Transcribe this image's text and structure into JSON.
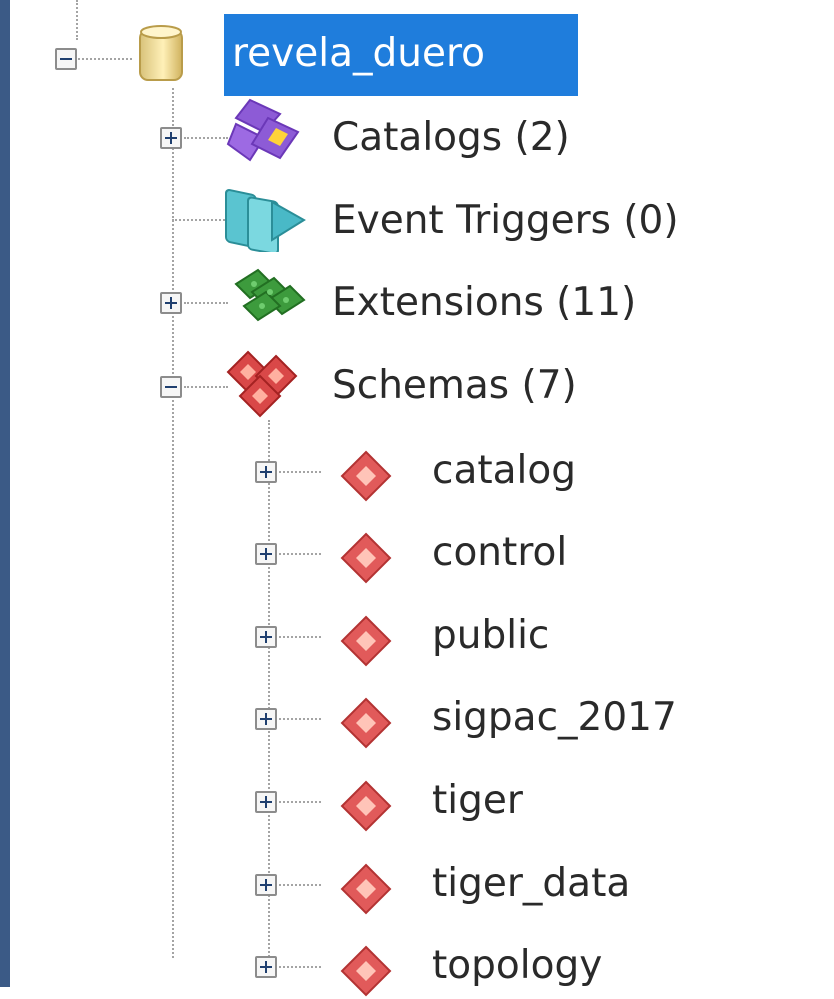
{
  "tree": {
    "root": {
      "label": "revela_duero",
      "icon": "database-icon",
      "expanded": true,
      "selected": true
    },
    "children": [
      {
        "label": "Catalogs (2)",
        "icon": "catalogs-icon",
        "expanded": false
      },
      {
        "label": "Event Triggers (0)",
        "icon": "event-triggers-icon",
        "expanded": null
      },
      {
        "label": "Extensions (11)",
        "icon": "extensions-icon",
        "expanded": false
      },
      {
        "label": "Schemas (7)",
        "icon": "schemas-icon",
        "expanded": true
      }
    ],
    "schemas": [
      {
        "label": "catalog",
        "icon": "schema-icon"
      },
      {
        "label": "control",
        "icon": "schema-icon"
      },
      {
        "label": "public",
        "icon": "schema-icon"
      },
      {
        "label": "sigpac_2017",
        "icon": "schema-icon"
      },
      {
        "label": "tiger",
        "icon": "schema-icon"
      },
      {
        "label": "tiger_data",
        "icon": "schema-icon"
      },
      {
        "label": "topology",
        "icon": "schema-icon"
      }
    ]
  },
  "colors": {
    "selection": "#1f7ddc",
    "text": "#2a2a2a",
    "schema_icon": "#e05a5a"
  }
}
